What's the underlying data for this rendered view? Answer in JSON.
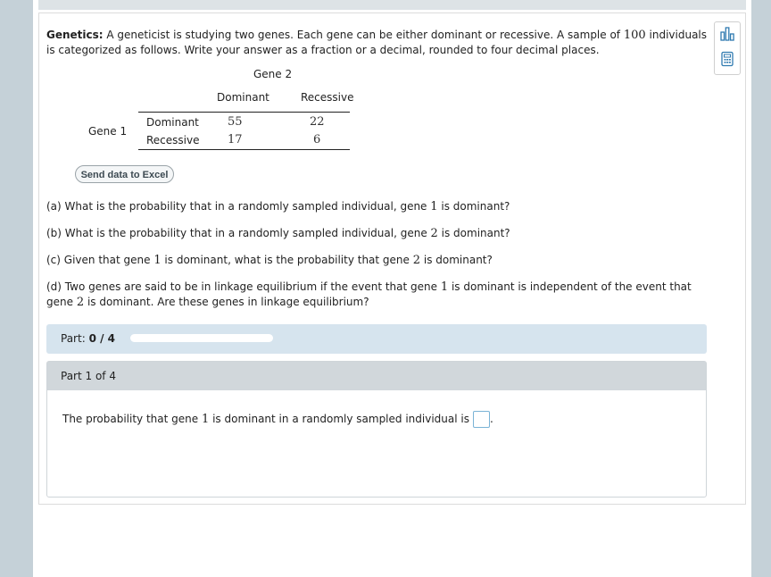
{
  "problem": {
    "title": "Genetics:",
    "text_1": "A geneticist is studying two genes. Each gene can be either dominant or recessive. A sample of",
    "sample_size": "100",
    "text_2": "individuals is categorized as follows. Write your answer as a fraction or a decimal, rounded to four decimal places."
  },
  "table": {
    "col_group": "Gene 2",
    "row_group": "Gene 1",
    "columns": [
      "Dominant",
      "Recessive"
    ],
    "rows": [
      {
        "label": "Dominant",
        "values": [
          "55",
          "22"
        ]
      },
      {
        "label": "Recessive",
        "values": [
          "17",
          "6"
        ]
      }
    ]
  },
  "excel_button": "Send data to Excel",
  "questions": {
    "a_pre": "(a) What is the probability that in a randomly sampled individual, gene",
    "a_num": "1",
    "a_post": "is dominant?",
    "b_pre": "(b) What is the probability that in a randomly sampled individual, gene",
    "b_num": "2",
    "b_post": "is dominant?",
    "c_pre": "(c) Given that gene",
    "c_num1": "1",
    "c_mid": "is dominant, what is the probability that gene",
    "c_num2": "2",
    "c_post": "is dominant?",
    "d_pre": "(d) Two genes are said to be in linkage equilibrium if the event that gene",
    "d_num1": "1",
    "d_mid": "is dominant is independent of the event that gene",
    "d_num2": "2",
    "d_post": "is dominant. Are these genes in linkage equilibrium?"
  },
  "progress": {
    "label": "Part:",
    "value": "0 / 4",
    "fraction": 0
  },
  "part": {
    "header": "Part 1 of 4",
    "answer_pre": "The probability that gene",
    "answer_num": "1",
    "answer_post": "is dominant in a randomly sampled individual is",
    "answer_end": "."
  },
  "icons": {
    "tool1": "bar-chart-icon",
    "tool2": "calculator-icon"
  }
}
